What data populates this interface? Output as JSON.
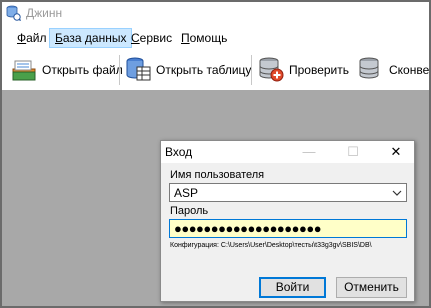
{
  "window": {
    "title": "Джинн",
    "icon": "app-db-icon"
  },
  "menu": {
    "items": [
      {
        "label": "Файл",
        "accel": "Ф"
      },
      {
        "label": "База данных",
        "accel": "Б",
        "active": true
      },
      {
        "label": "Сервис",
        "accel": "С"
      },
      {
        "label": "Помощь",
        "accel": "П"
      }
    ]
  },
  "toolbar": {
    "buttons": [
      {
        "label": "Открыть файл",
        "icon": "open-file-icon"
      },
      {
        "label": "Открыть таблицу",
        "icon": "open-table-icon"
      },
      {
        "label": "Проверить",
        "icon": "check-database-icon"
      },
      {
        "label": "Сконвер",
        "icon": "convert-database-icon"
      }
    ]
  },
  "dialog": {
    "title": "Вход",
    "username_label": "Имя пользователя",
    "username_value": "ASP",
    "password_label": "Пароль",
    "password_value": "●●●●●●●●●●●●●●●●●●●●",
    "config_label": "Конфигурация:",
    "config_path": "C:\\Users\\User\\Desktop\\тесты\\t33g3gv\\SBIS\\DB\\",
    "ok_label": "Войти",
    "cancel_label": "Отменить"
  },
  "colors": {
    "workspace": "#a8a8a8",
    "menu_active": "#cce8ff",
    "password_bg": "#ffffc8",
    "focus_border": "#0078d7"
  }
}
